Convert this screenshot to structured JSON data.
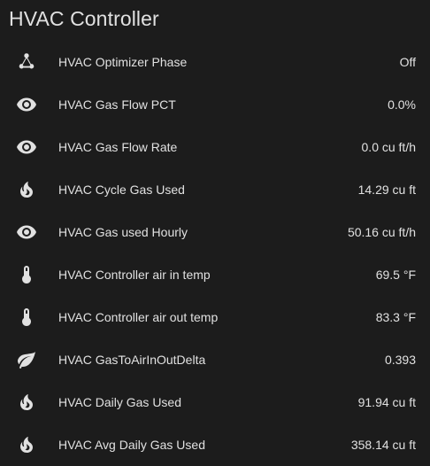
{
  "card": {
    "title": "HVAC Controller"
  },
  "rows": [
    {
      "icon": "graph-network-icon",
      "label": "HVAC Optimizer Phase",
      "value": "Off"
    },
    {
      "icon": "eye-icon",
      "label": "HVAC Gas Flow PCT",
      "value": "0.0%"
    },
    {
      "icon": "eye-icon",
      "label": "HVAC Gas Flow Rate",
      "value": "0.0 cu ft/h"
    },
    {
      "icon": "fire-icon",
      "label": "HVAC Cycle Gas Used",
      "value": "14.29 cu ft"
    },
    {
      "icon": "eye-icon",
      "label": "HVAC Gas used Hourly",
      "value": "50.16 cu ft/h"
    },
    {
      "icon": "thermometer-icon",
      "label": "HVAC Controller air in temp",
      "value": "69.5 °F"
    },
    {
      "icon": "thermometer-icon",
      "label": "HVAC Controller air out temp",
      "value": "83.3 °F"
    },
    {
      "icon": "leaf-icon",
      "label": "HVAC GasToAirInOutDelta",
      "value": "0.393"
    },
    {
      "icon": "fire-icon",
      "label": "HVAC Daily Gas Used",
      "value": "91.94 cu ft"
    },
    {
      "icon": "fire-icon",
      "label": "HVAC Avg Daily Gas Used",
      "value": "358.14 cu ft"
    }
  ],
  "colors": {
    "background": "#1c1c1c",
    "text": "#e1e1e1",
    "icon": "#e1e1e1"
  }
}
